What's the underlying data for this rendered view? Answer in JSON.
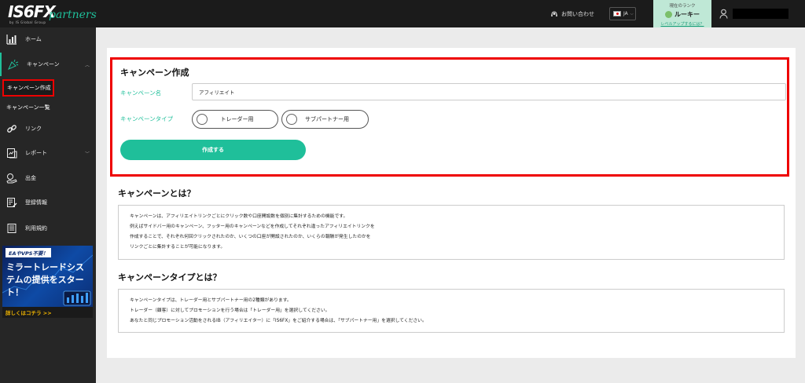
{
  "header": {
    "logo_main": "IS6FX",
    "logo_script": "partners",
    "logo_tagline": "by IS Global Group",
    "contact_label": "お問い合わせ",
    "lang_code": "JA",
    "rank": {
      "label": "現在のランク",
      "name": "ルーキー",
      "link": "レベルアップするには？"
    }
  },
  "sidebar": {
    "items": [
      {
        "label": "ホーム",
        "icon": "bar-chart-icon"
      },
      {
        "label": "キャンペーン",
        "icon": "party-popper-icon"
      },
      {
        "label": "リンク",
        "icon": "link-icon"
      },
      {
        "label": "レポート",
        "icon": "report-icon"
      },
      {
        "label": "出金",
        "icon": "withdraw-icon"
      },
      {
        "label": "登録情報",
        "icon": "profile-edit-icon"
      },
      {
        "label": "利用規約",
        "icon": "terms-icon"
      }
    ],
    "sub_items": [
      {
        "label": "キャンペーン作成"
      },
      {
        "label": "キャンペーン一覧"
      }
    ],
    "banner": {
      "tag": "EAやVPS不要！",
      "headline": "ミラートレードシステムの提供をスタート！",
      "footer": "詳しくはコチラ >>"
    }
  },
  "main": {
    "create": {
      "title": "キャンペーン作成",
      "name_label": "キャンペーン名",
      "name_value": "アフィリエイト",
      "type_label": "キャンペーンタイプ",
      "type_options": [
        "トレーダー用",
        "サブパートナー用"
      ],
      "submit_label": "作成する"
    },
    "about": {
      "title": "キャンペーンとは？",
      "lines": [
        "キャンペーンは、アフィリエイトリンクごとにクリック数や口座開設数を個別に集計するための機能です。",
        "例えばサイドバー用のキャンペーン、フッター用のキャンペーンなどを作成してそれぞれ違ったアフィリエイトリンクを",
        "作成することで、それぞれ何回クリックされたのか、いくつの口座が開設されたのか、いくらの報酬が発生したのかを",
        "リンクごとに集計することが可能になります。"
      ]
    },
    "types": {
      "title": "キャンペーンタイプとは？",
      "lines": [
        "キャンペーンタイプは、トレーダー用とサブパートナー用の2種類があります。",
        "トレーダー（顧客）に対してプロモーションを行う場合は「トレーダー用」を選択してください。",
        "あなたと同じプロモーション活動をされるIB（アフィリエイター）に「IS6FX」をご紹介する場合は、「サブパートナー用」を選択してください。"
      ]
    }
  },
  "colors": {
    "accent": "#1fbf9a",
    "highlight": "#e00000",
    "sidebar_bg": "#262626",
    "topbar_bg": "#1b1b1b"
  }
}
